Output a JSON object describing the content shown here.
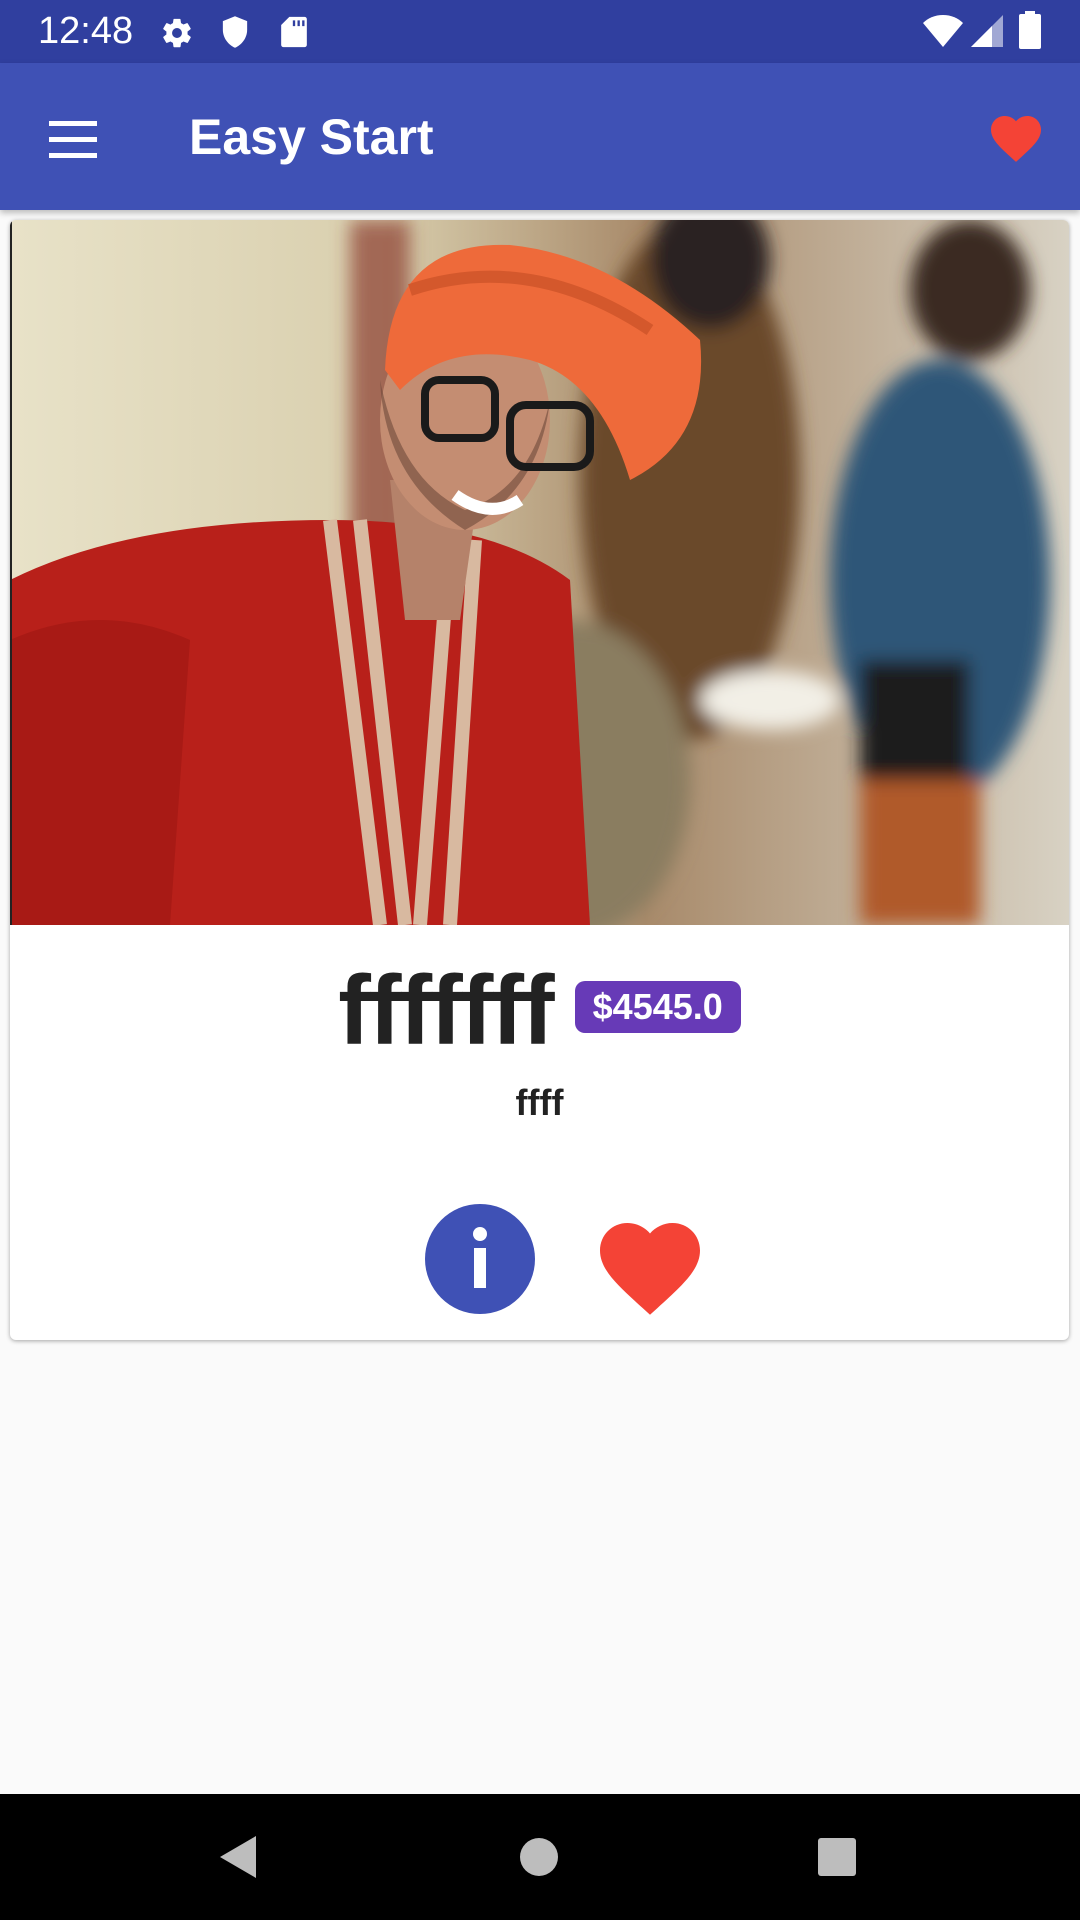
{
  "status_bar": {
    "time": "12:48",
    "icons": [
      "settings-icon",
      "shield-icon",
      "sd-card-icon",
      "wifi-icon",
      "signal-icon",
      "battery-icon"
    ]
  },
  "app_bar": {
    "title": "Easy Start",
    "menu_icon": "menu-icon",
    "favorite_icon": "heart-icon"
  },
  "card": {
    "image": "photo of smiling man in orange turban and red kurta",
    "title": "fffffff",
    "price": "$4545.0",
    "subtitle": "ffff",
    "info_icon": "info-icon",
    "favorite_icon": "heart-icon"
  },
  "nav_bar": {
    "buttons": [
      "back-icon",
      "home-icon",
      "recents-icon"
    ]
  },
  "colors": {
    "status_bar": "#303f9f",
    "app_bar": "#3f51b5",
    "price_badge": "#673ab7",
    "heart": "#f44336",
    "info": "#3f51b5",
    "background": "#fafafa"
  }
}
